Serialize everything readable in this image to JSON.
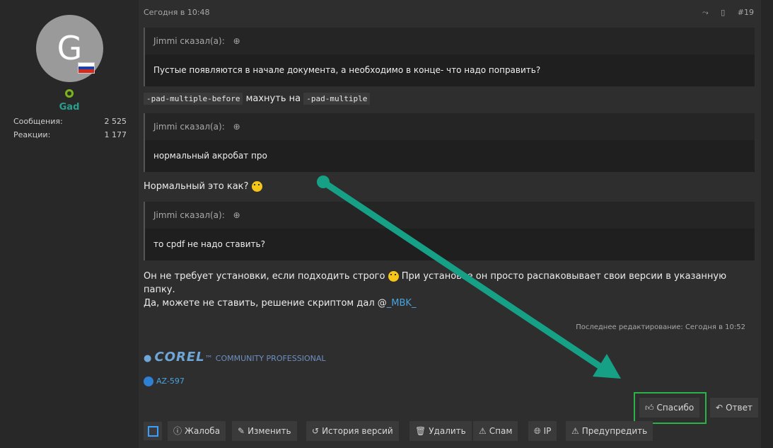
{
  "user": {
    "avatar_letter": "G",
    "name": "Gad",
    "messages_label": "Сообщения:",
    "messages_value": "2 525",
    "reactions_label": "Реакции:",
    "reactions_value": "1 177"
  },
  "post": {
    "date": "Сегодня в 10:48",
    "number": "#19",
    "quote1_author": "Jimmi сказал(а):",
    "quote1_text": "Пустые появляются в начале документа, а необходимо в конце- что надо поправить?",
    "code1": "-pad-multiple-before",
    "code_mid": "махнуть на",
    "code2": "-pad-multiple",
    "quote2_author": "Jimmi сказал(а):",
    "quote2_text": "нормальный акробат про",
    "line_normal": "Нормальный это как?",
    "quote3_author": "Jimmi сказал(а):",
    "quote3_text": "то cpdf не надо ставить?",
    "para1": "Он не требует установки, если подходить строго",
    "para1b": "При установке он просто распаковывает свои версии в указанную",
    "para2": "папку.",
    "para3": "Да, можете не ставить, решение скриптом дал @",
    "mention": "_MBK_",
    "edited": "Последнее редактирование: Сегодня в 10:52",
    "sig_corel": "COREL",
    "sig_tm": "™",
    "sig_rest": "COMMUNITY PROFESSIONAL",
    "reaction_user": "AZ-597"
  },
  "actions": {
    "thanks": "Спасибо",
    "reply": "Ответ",
    "report": "Жалоба",
    "edit": "Изменить",
    "history": "История версий",
    "delete": "Удалить",
    "spam": "Спам",
    "ip": "IP",
    "warn": "Предупредить"
  },
  "colors": {
    "highlight": "#2bb34a",
    "arrow": "#16a085"
  }
}
